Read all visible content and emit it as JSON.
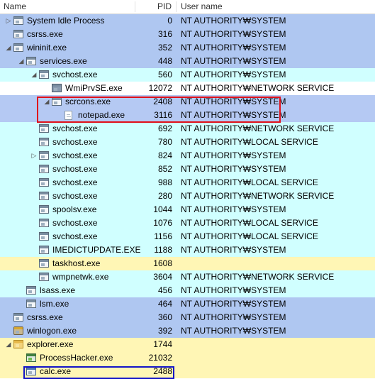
{
  "columns": {
    "name": "Name",
    "pid": "PID",
    "user": "User name"
  },
  "colors": {
    "system_service": "#afc7f1",
    "service": "#d0ffff",
    "selected": "#b5c9f3",
    "own_process": "#fff6b5",
    "plain": "#ffffff",
    "highlight_red": "#e0101a",
    "highlight_blue": "#1414c8"
  },
  "processes": [
    {
      "name": "System Idle Process",
      "pid": "0",
      "user": "NT AUTHORITY₩SYSTEM",
      "bg": "system_service",
      "level": 0,
      "toggle": "collapsed",
      "icon": "window-icon"
    },
    {
      "name": "csrss.exe",
      "pid": "316",
      "user": "NT AUTHORITY₩SYSTEM",
      "bg": "system_service",
      "level": 0,
      "toggle": "",
      "icon": "window-icon"
    },
    {
      "name": "wininit.exe",
      "pid": "352",
      "user": "NT AUTHORITY₩SYSTEM",
      "bg": "system_service",
      "level": 0,
      "toggle": "expanded",
      "icon": "window-icon"
    },
    {
      "name": "services.exe",
      "pid": "448",
      "user": "NT AUTHORITY₩SYSTEM",
      "bg": "system_service",
      "level": 1,
      "toggle": "expanded",
      "icon": "window-icon"
    },
    {
      "name": "svchost.exe",
      "pid": "560",
      "user": "NT AUTHORITY₩SYSTEM",
      "bg": "service",
      "level": 2,
      "toggle": "expanded",
      "icon": "window-icon"
    },
    {
      "name": "WmiPrvSE.exe",
      "pid": "12072",
      "user": "NT AUTHORITY₩NETWORK SERVICE",
      "bg": "plain",
      "level": 3,
      "toggle": "",
      "icon": "wmi-icon"
    },
    {
      "name": "scrcons.exe",
      "pid": "2408",
      "user": "NT AUTHORITY₩SYSTEM",
      "bg": "selected",
      "level": 3,
      "toggle": "expanded",
      "icon": "window-icon"
    },
    {
      "name": "notepad.exe",
      "pid": "3116",
      "user": "NT AUTHORITY₩SYSTEM",
      "bg": "selected",
      "level": 4,
      "toggle": "",
      "icon": "document-icon"
    },
    {
      "name": "svchost.exe",
      "pid": "692",
      "user": "NT AUTHORITY₩NETWORK SERVICE",
      "bg": "service",
      "level": 2,
      "toggle": "",
      "icon": "window-icon"
    },
    {
      "name": "svchost.exe",
      "pid": "780",
      "user": "NT AUTHORITY₩LOCAL SERVICE",
      "bg": "service",
      "level": 2,
      "toggle": "",
      "icon": "window-icon"
    },
    {
      "name": "svchost.exe",
      "pid": "824",
      "user": "NT AUTHORITY₩SYSTEM",
      "bg": "service",
      "level": 2,
      "toggle": "collapsed",
      "icon": "window-icon"
    },
    {
      "name": "svchost.exe",
      "pid": "852",
      "user": "NT AUTHORITY₩SYSTEM",
      "bg": "service",
      "level": 2,
      "toggle": "",
      "icon": "window-icon"
    },
    {
      "name": "svchost.exe",
      "pid": "988",
      "user": "NT AUTHORITY₩LOCAL SERVICE",
      "bg": "service",
      "level": 2,
      "toggle": "",
      "icon": "window-icon"
    },
    {
      "name": "svchost.exe",
      "pid": "280",
      "user": "NT AUTHORITY₩NETWORK SERVICE",
      "bg": "service",
      "level": 2,
      "toggle": "",
      "icon": "window-icon"
    },
    {
      "name": "spoolsv.exe",
      "pid": "1044",
      "user": "NT AUTHORITY₩SYSTEM",
      "bg": "service",
      "level": 2,
      "toggle": "",
      "icon": "window-icon"
    },
    {
      "name": "svchost.exe",
      "pid": "1076",
      "user": "NT AUTHORITY₩LOCAL SERVICE",
      "bg": "service",
      "level": 2,
      "toggle": "",
      "icon": "window-icon"
    },
    {
      "name": "svchost.exe",
      "pid": "1156",
      "user": "NT AUTHORITY₩LOCAL SERVICE",
      "bg": "service",
      "level": 2,
      "toggle": "",
      "icon": "window-icon"
    },
    {
      "name": "IMEDICTUPDATE.EXE",
      "pid": "1188",
      "user": "NT AUTHORITY₩SYSTEM",
      "bg": "service",
      "level": 2,
      "toggle": "",
      "icon": "window-icon"
    },
    {
      "name": "taskhost.exe",
      "pid": "1608",
      "user": "",
      "bg": "own_process",
      "level": 2,
      "toggle": "",
      "icon": "window-icon"
    },
    {
      "name": "wmpnetwk.exe",
      "pid": "3604",
      "user": "NT AUTHORITY₩NETWORK SERVICE",
      "bg": "service",
      "level": 2,
      "toggle": "",
      "icon": "window-icon"
    },
    {
      "name": "lsass.exe",
      "pid": "456",
      "user": "NT AUTHORITY₩SYSTEM",
      "bg": "service",
      "level": 1,
      "toggle": "",
      "icon": "window-icon"
    },
    {
      "name": "lsm.exe",
      "pid": "464",
      "user": "NT AUTHORITY₩SYSTEM",
      "bg": "system_service",
      "level": 1,
      "toggle": "",
      "icon": "window-icon"
    },
    {
      "name": "csrss.exe",
      "pid": "360",
      "user": "NT AUTHORITY₩SYSTEM",
      "bg": "system_service",
      "level": 0,
      "toggle": "",
      "icon": "window-icon"
    },
    {
      "name": "winlogon.exe",
      "pid": "392",
      "user": "NT AUTHORITY₩SYSTEM",
      "bg": "system_service",
      "level": 0,
      "toggle": "",
      "icon": "gear-icon"
    },
    {
      "name": "explorer.exe",
      "pid": "1744",
      "user": "",
      "bg": "own_process",
      "level": 0,
      "toggle": "expanded",
      "icon": "folder-icon"
    },
    {
      "name": "ProcessHacker.exe",
      "pid": "21032",
      "user": "",
      "bg": "own_process",
      "level": 1,
      "toggle": "",
      "icon": "processhacker-icon"
    },
    {
      "name": "calc.exe",
      "pid": "2488",
      "user": "",
      "bg": "own_process",
      "level": 1,
      "toggle": "",
      "icon": "calculator-icon"
    }
  ]
}
